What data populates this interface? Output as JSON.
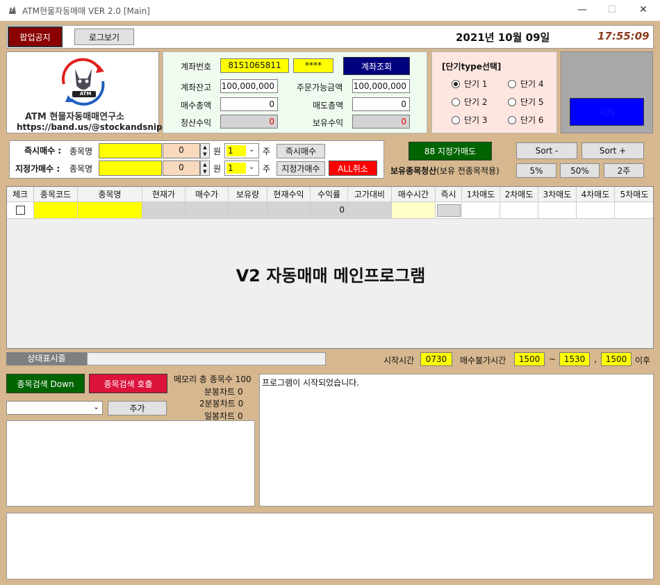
{
  "window": {
    "title": "ATM현물자동매매 VER 2.0 [Main]"
  },
  "header": {
    "popup_notice": "팝업공지",
    "log_view": "로그보기",
    "date": "2021년 10월 09일",
    "time": "17:55:09"
  },
  "logo": {
    "badge": "ATM",
    "org_name": "ATM 현물자동매매연구소",
    "url": "https://band.us/@stockandsniper"
  },
  "account": {
    "account_no_label": "계좌번호",
    "account_no": "8151065811",
    "password": "****",
    "query_button": "계좌조회",
    "balance_label": "계좌잔고",
    "balance": "100,000,000",
    "orderable_label": "주문가능금액",
    "orderable": "100,000,000",
    "buy_total_label": "매수총액",
    "buy_total": "0",
    "sell_total_label": "매도총액",
    "sell_total": "0",
    "realized_label": "청산수익",
    "realized": "0",
    "holding_label": "보유수익",
    "holding": "0"
  },
  "strategy": {
    "title": "[단기type선택]",
    "options": [
      "단기 1",
      "단기 2",
      "단기 3",
      "단기 4",
      "단기 5",
      "단기 6"
    ],
    "selected": "단기 1"
  },
  "start_button": "시작",
  "orders": {
    "market_label": "즉시매수 :",
    "limit_label": "지정가매수 :",
    "stock_name_label": "종목명",
    "price_market": "0",
    "price_limit": "0",
    "won": "원",
    "qty_market": "1",
    "qty_limit": "1",
    "shares": "주",
    "market_button": "즉시매수",
    "limit_button": "지정가매수",
    "cancel_all_button": "ALL취소",
    "sell88_button": "88 지정가매도",
    "sort_minus": "Sort -",
    "sort_plus": "Sort +",
    "liquidate_label": "보유종목청산",
    "liquidate_note": "(보유 전종목적용)",
    "pct5": "5%",
    "pct50": "50%",
    "shares2": "2주"
  },
  "grid": {
    "headers": [
      "체크",
      "종목코드",
      "종목명",
      "현재가",
      "매수가",
      "보유량",
      "현재수익",
      "수익률",
      "고가대비",
      "매수시간",
      "즉시",
      "1차매도",
      "2차매도",
      "3차매도",
      "4차매도",
      "5차매도"
    ],
    "row_profit": "0",
    "center_text": "V2 자동매매 메인프로그램"
  },
  "status": {
    "label": "상태표시줄",
    "start_time_label": "시작시간",
    "start_time": "0730",
    "no_buy_label": "매수불가시간",
    "no_buy_from": "1500",
    "tilde": "~",
    "no_buy_to": "1530",
    "comma": ",",
    "after_time": "1500",
    "after_label": "이후"
  },
  "search": {
    "download_button": "종목검색 Down",
    "call_button": "종목검색 호출",
    "add_button": "추가",
    "memory_label": "메모리 총 종목수 100",
    "minute_chart": "분봉차트 0",
    "two_minute_chart": "2분봉차트 0",
    "daily_chart": "일봉차트 0"
  },
  "log": {
    "message": "프로그램이 시작되었습니다."
  },
  "colors": {
    "background": "#d6b78f",
    "popup_button": "#8b0000",
    "query_button": "#00007f",
    "start_button": "#0000ff",
    "sell_button": "#006400",
    "cancel_button": "#ff0000",
    "download_button": "#006400",
    "call_button": "#dc143c"
  }
}
